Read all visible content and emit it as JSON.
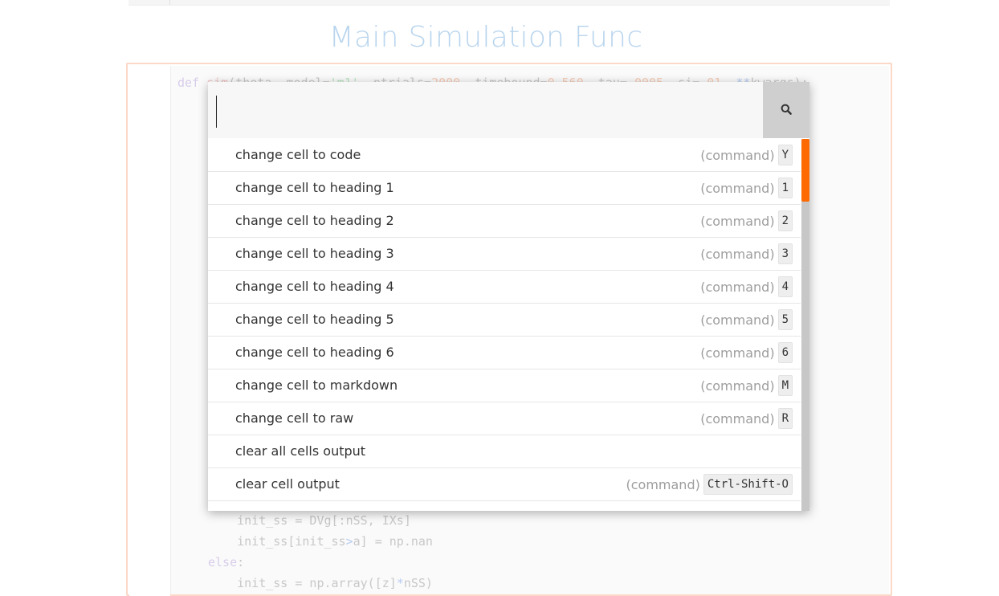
{
  "notebook": {
    "heading": "Main Simulation Func",
    "code_lines": [
      {
        "segments": [
          [
            "kw",
            "def "
          ],
          [
            "fn",
            "sim"
          ],
          [
            "",
            "(theta, model="
          ],
          [
            "str",
            "'m1'"
          ],
          [
            "",
            ", ntrials="
          ],
          [
            "num",
            "2000"
          ],
          [
            "",
            ", timebound="
          ],
          [
            "num",
            "0.560"
          ],
          [
            "",
            ", tau="
          ],
          [
            "num",
            ".0005"
          ],
          [
            "",
            ", si="
          ],
          [
            "num",
            ".01"
          ],
          [
            "",
            ", "
          ],
          [
            "op",
            "**"
          ],
          [
            "",
            "kwargs):"
          ]
        ]
      },
      {
        "segments": [
          [
            "",
            "    init_ss = DVg[:nSS, IXs]"
          ]
        ]
      },
      {
        "segments": [
          [
            "",
            "    init_ss[init_ss"
          ],
          [
            "op",
            ">"
          ],
          [
            "",
            "a] = np.nan"
          ]
        ]
      },
      {
        "segments": [
          [
            "kw",
            "else"
          ],
          [
            "",
            ":"
          ]
        ]
      },
      {
        "segments": [
          [
            "",
            "    init_ss = np.array([z]"
          ],
          [
            "op",
            "*"
          ],
          [
            "",
            "nSS)"
          ]
        ]
      }
    ]
  },
  "palette": {
    "search": {
      "value": "",
      "placeholder": ""
    },
    "search_icon": "search-icon",
    "accent_color": "#ff6a00",
    "items": [
      {
        "label": "change cell to code",
        "context": "(command)",
        "shortcut": "Y"
      },
      {
        "label": "change cell to heading 1",
        "context": "(command)",
        "shortcut": "1"
      },
      {
        "label": "change cell to heading 2",
        "context": "(command)",
        "shortcut": "2"
      },
      {
        "label": "change cell to heading 3",
        "context": "(command)",
        "shortcut": "3"
      },
      {
        "label": "change cell to heading 4",
        "context": "(command)",
        "shortcut": "4"
      },
      {
        "label": "change cell to heading 5",
        "context": "(command)",
        "shortcut": "5"
      },
      {
        "label": "change cell to heading 6",
        "context": "(command)",
        "shortcut": "6"
      },
      {
        "label": "change cell to markdown",
        "context": "(command)",
        "shortcut": "M"
      },
      {
        "label": "change cell to raw",
        "context": "(command)",
        "shortcut": "R"
      },
      {
        "label": "clear all cells output",
        "context": "",
        "shortcut": ""
      },
      {
        "label": "clear cell output",
        "context": "(command)",
        "shortcut": "Ctrl-Shift-O"
      }
    ]
  }
}
